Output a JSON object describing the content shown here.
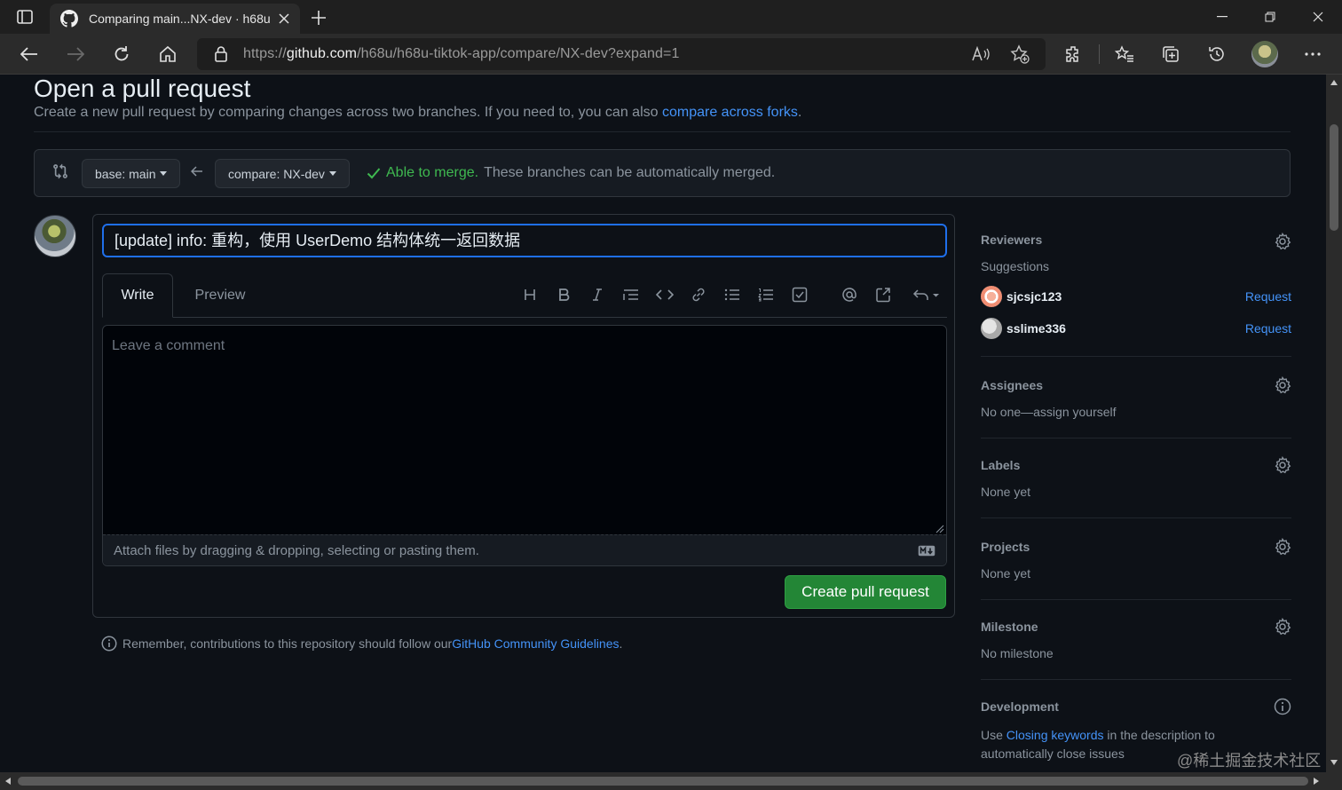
{
  "browser": {
    "tab_title": "Comparing main...NX-dev · h68u/h68u-tiktok-app",
    "url_scheme": "https://",
    "url_host": "github.com",
    "url_path": "/h68u/h68u-tiktok-app/compare/NX-dev?expand=1"
  },
  "page": {
    "heading": "Open a pull request",
    "subhead_prefix": "Create a new pull request by comparing changes across two branches. If you need to, you can also ",
    "subhead_link": "compare across forks",
    "subhead_suffix": "."
  },
  "range": {
    "base_label": "base: main",
    "compare_label": "compare: NX-dev",
    "merge_ok": "Able to merge.",
    "merge_text": "These branches can be automatically merged."
  },
  "form": {
    "title_value": "[update] info: 重构，使用 UserDemo 结构体统一返回数据",
    "tab_write": "Write",
    "tab_preview": "Preview",
    "comment_placeholder": "Leave a comment",
    "attach_text": "Attach files by dragging & dropping, selecting or pasting them.",
    "submit_label": "Create pull request"
  },
  "footer_note": {
    "prefix": "Remember, contributions to this repository should follow our ",
    "link": "GitHub Community Guidelines",
    "suffix": "."
  },
  "sidebar": {
    "reviewers": {
      "title": "Reviewers",
      "suggestions": "Suggestions",
      "items": [
        {
          "name": "sjcsjc123",
          "action": "Request"
        },
        {
          "name": "sslime336",
          "action": "Request"
        }
      ]
    },
    "assignees": {
      "title": "Assignees",
      "text": "No one—assign yourself"
    },
    "labels": {
      "title": "Labels",
      "text": "None yet"
    },
    "projects": {
      "title": "Projects",
      "text": "None yet"
    },
    "milestone": {
      "title": "Milestone",
      "text": "No milestone"
    },
    "development": {
      "title": "Development",
      "prefix": "Use ",
      "link": "Closing keywords",
      "suffix": " in the description to automatically close issues"
    }
  },
  "watermark": "@稀土掘金技术社区",
  "colors": {
    "accent_blue": "#4493f8",
    "success_green": "#3fb950",
    "button_green": "#238636",
    "focus_blue": "#1f6feb"
  }
}
